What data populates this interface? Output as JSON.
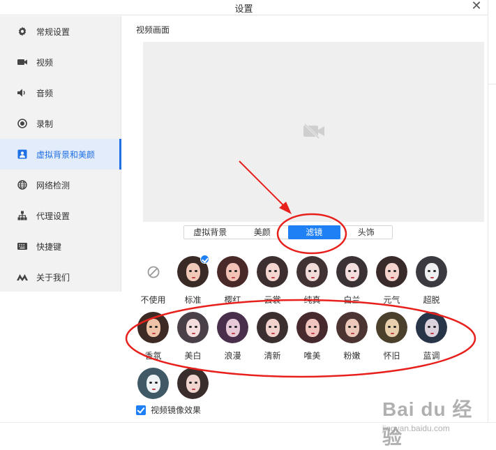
{
  "window": {
    "title": "设置",
    "close_glyph": "✕"
  },
  "sidebar": {
    "items": [
      {
        "label": "常规设置",
        "icon": "gear-icon",
        "active": false
      },
      {
        "label": "视频",
        "icon": "video-camera-icon",
        "active": false
      },
      {
        "label": "音频",
        "icon": "speaker-icon",
        "active": false
      },
      {
        "label": "录制",
        "icon": "record-icon",
        "active": false
      },
      {
        "label": "虚拟背景和美颜",
        "icon": "portrait-icon",
        "active": true
      },
      {
        "label": "网络检测",
        "icon": "globe-icon",
        "active": false
      },
      {
        "label": "代理设置",
        "icon": "network-tree-icon",
        "active": false
      },
      {
        "label": "快捷键",
        "icon": "keyboard-icon",
        "active": false
      },
      {
        "label": "关于我们",
        "icon": "logo-icon",
        "active": false
      }
    ]
  },
  "main": {
    "section_title": "视频画面",
    "preview_icon": "camera-off-icon",
    "tabs": [
      {
        "label": "虚拟背景",
        "active": false
      },
      {
        "label": "美颜",
        "active": false
      },
      {
        "label": "滤镜",
        "active": true
      },
      {
        "label": "头饰",
        "active": false
      }
    ],
    "filters": [
      [
        {
          "label": "不使用",
          "type": "none",
          "icon": "disabled-icon"
        },
        {
          "label": "标准",
          "selected": true,
          "hair": "#3a2a26",
          "skin": "#f0c9b8"
        },
        {
          "label": "樱红",
          "hair": "#4a2a28",
          "skin": "#f3c2b7"
        },
        {
          "label": "云裳",
          "hair": "#3d2f30",
          "skin": "#f4d5d0"
        },
        {
          "label": "纯真",
          "hair": "#413334",
          "skin": "#f2dcd9"
        },
        {
          "label": "白兰",
          "hair": "#3b3235",
          "skin": "#f4dfde"
        },
        {
          "label": "元气",
          "hair": "#3a2b2b",
          "skin": "#f5d4cd"
        },
        {
          "label": "超脱",
          "hair": "#3b3a40",
          "skin": "#eef0f1"
        }
      ],
      [
        {
          "label": "香氛",
          "hair": "#3e2a24",
          "skin": "#f0c4a8"
        },
        {
          "label": "美白",
          "hair": "#4a4048",
          "skin": "#f3dedd"
        },
        {
          "label": "浪漫",
          "hair": "#4a2f4c",
          "skin": "#e7c9d8"
        },
        {
          "label": "清新",
          "hair": "#3b2f30",
          "skin": "#f1d2cd"
        },
        {
          "label": "唯美",
          "hair": "#472a2d",
          "skin": "#f2c4bf"
        },
        {
          "label": "粉嫩",
          "hair": "#4b3432",
          "skin": "#ecc9bb"
        },
        {
          "label": "怀旧",
          "hair": "#4a402c",
          "skin": "#e8cfae"
        },
        {
          "label": "蓝调",
          "hair": "#283448",
          "skin": "#dcd2de"
        }
      ],
      [
        {
          "label": "",
          "hair": "#3f5a66",
          "skin": "#eef4f6"
        },
        {
          "label": "",
          "hair": "#3a2e2c",
          "skin": "#f1d6cf"
        }
      ]
    ],
    "mirror": {
      "label": "视频镜像效果",
      "checked": true
    }
  },
  "watermark": {
    "main": "Bai du 经验",
    "url": "jingyan.baidu.com"
  },
  "colors": {
    "accent": "#1f7ff5",
    "annotation": "#e8201c",
    "sidebar_bg": "#f2f2f2"
  }
}
